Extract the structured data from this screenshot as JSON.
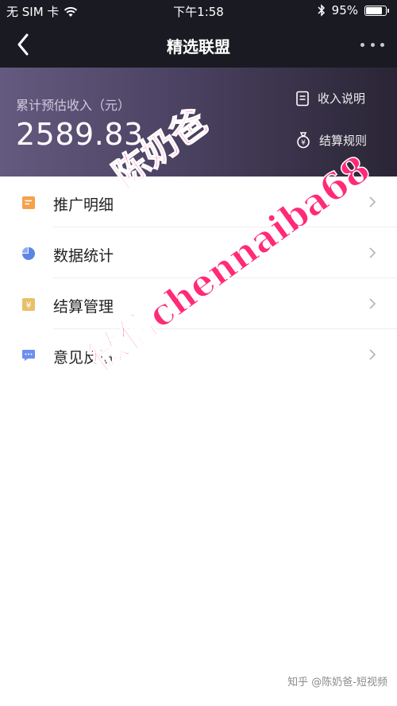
{
  "status_bar": {
    "carrier": "无 SIM 卡",
    "time": "下午1:58",
    "battery": "95%"
  },
  "nav": {
    "title": "精选联盟"
  },
  "earnings": {
    "label": "累计预估收入（元）",
    "amount": "2589.83",
    "income_link": "收入说明",
    "rules_link": "结算规则"
  },
  "menu": {
    "items": [
      {
        "label": "推广明细",
        "icon": "orange-doc-icon",
        "color": "#f5a14c"
      },
      {
        "label": "数据统计",
        "icon": "pie-chart-icon",
        "color": "#5b86e5"
      },
      {
        "label": "结算管理",
        "icon": "yuan-icon",
        "color": "#e8c069"
      },
      {
        "label": "意见反馈",
        "icon": "chat-bubble-icon",
        "color": "#6c8ff0"
      }
    ]
  },
  "watermarks": {
    "line1": "陈奶爸",
    "line2": "微信chennaiba68",
    "footer": "知乎 @陈奶爸-短视频"
  },
  "colors": {
    "header_bg": "#1a1b22",
    "banner_start": "#645a7f",
    "banner_end": "#2a2535",
    "watermark": "#ff2a78"
  }
}
